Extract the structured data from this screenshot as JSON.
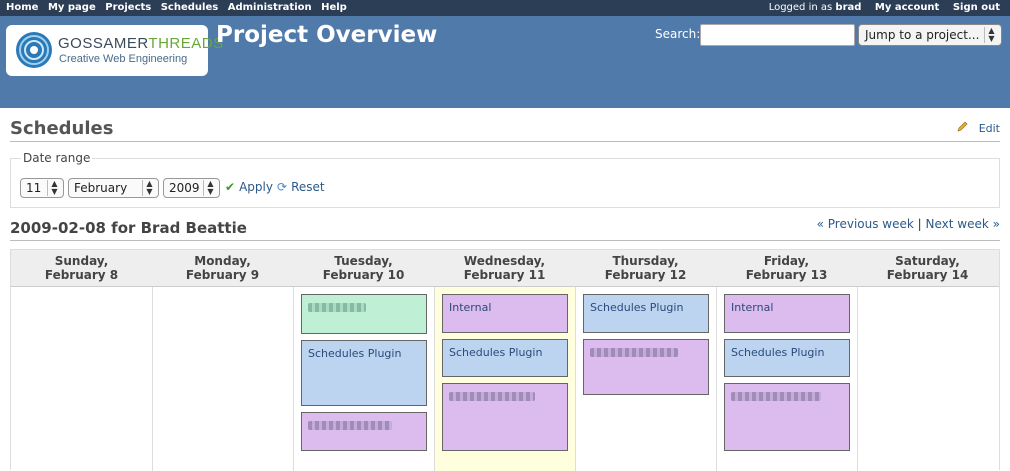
{
  "topmenu": {
    "items": [
      "Home",
      "My page",
      "Projects",
      "Schedules",
      "Administration",
      "Help"
    ],
    "logged_in_prefix": "Logged in as",
    "username": "brad",
    "my_account": "My account",
    "sign_out": "Sign out"
  },
  "logo": {
    "word_gossamer": "GOSSAMER",
    "word_threads": "THREADS",
    "tagline": "Creative Web Engineering"
  },
  "header": {
    "project_title": "Project Overview",
    "search_label": "Search:",
    "search_value": "",
    "jump_label": "Jump to a project..."
  },
  "page": {
    "title": "Schedules",
    "edit_label": "Edit"
  },
  "date_range": {
    "legend": "Date range",
    "day": "11",
    "month": "February",
    "year": "2009",
    "apply_label": "Apply",
    "reset_label": "Reset"
  },
  "week": {
    "title": "2009-02-08 for Brad Beattie",
    "prev_label": "« Previous week",
    "separator": "|",
    "next_label": "Next week »"
  },
  "calendar": {
    "days": [
      {
        "weekday": "Sunday,",
        "date": "February 8"
      },
      {
        "weekday": "Monday,",
        "date": "February 9"
      },
      {
        "weekday": "Tuesday,",
        "date": "February 10"
      },
      {
        "weekday": "Wednesday,",
        "date": "February 11"
      },
      {
        "weekday": "Thursday,",
        "date": "February 12"
      },
      {
        "weekday": "Friday,",
        "date": "February 13"
      },
      {
        "weekday": "Saturday,",
        "date": "February 14"
      }
    ],
    "entries": {
      "tue_2": "Schedules Plugin",
      "wed_1": "Internal",
      "wed_2": "Schedules Plugin",
      "thu_1": "Schedules Plugin",
      "fri_1": "Internal",
      "fri_2": "Schedules Plugin"
    },
    "colors": {
      "green": "#bff0d6",
      "blue": "#bcd4f0",
      "purple": "#dcbcee",
      "today": "#ffffdd"
    }
  }
}
